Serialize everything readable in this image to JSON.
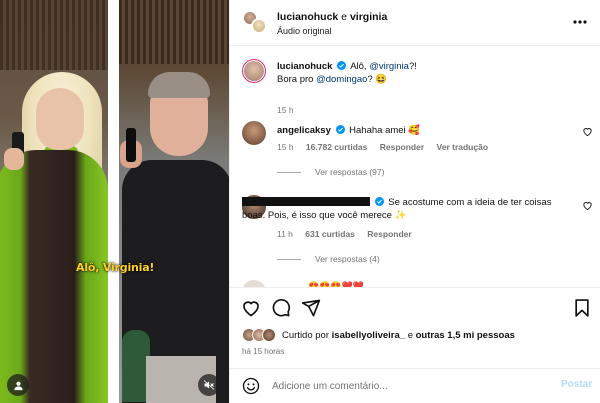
{
  "colors": {
    "link": "#00376b",
    "verified": "#0095f6",
    "muted": "#737373",
    "post_disabled": "#b3dbff",
    "caption": "#ffd21f"
  },
  "video": {
    "caption": "Alô, Virginia!"
  },
  "header": {
    "user": "lucianohuck",
    "connector": " e ",
    "collaborator": "virginia",
    "audio": "Áudio original"
  },
  "post": {
    "author": "lucianohuck",
    "line1_text": "Alô, ",
    "line1_mention": "@virginia",
    "line1_end": "?!",
    "line2_text": "Bora pro ",
    "line2_mention": "@domingao",
    "line2_end": "? 😆",
    "time": "15 h"
  },
  "comments": [
    {
      "username": "angelicaksy",
      "text": "Hahaha amei 🥰",
      "time": "15 h",
      "likes": "16.782 curtidas",
      "reply": "Responder",
      "translate": "Ver tradução",
      "view_replies": "Ver respostas (97)"
    },
    {
      "username": "",
      "text": "Se acostume com a ideia de ter coisas boas. Pois, é isso que você merece ✨",
      "time": "11 h",
      "likes": "631 curtidas",
      "reply": "Responder",
      "view_replies": "Ver respostas (4)"
    }
  ],
  "partial_comment_emojis": "😍😍😍❤️❤️",
  "likes": {
    "prefix": "Curtido por ",
    "user": "isabellyoliveira_",
    "middle": " e ",
    "others": "outras 1,5 mi pessoas"
  },
  "time_ago": "há 15 horas",
  "composer": {
    "placeholder": "Adicione um comentário...",
    "post_label": "Postar"
  },
  "icons": [
    "more-icon",
    "heart-icon",
    "comment-icon",
    "share-icon",
    "save-icon",
    "emoji-icon",
    "user-tag-icon",
    "mute-icon",
    "verified-icon"
  ]
}
